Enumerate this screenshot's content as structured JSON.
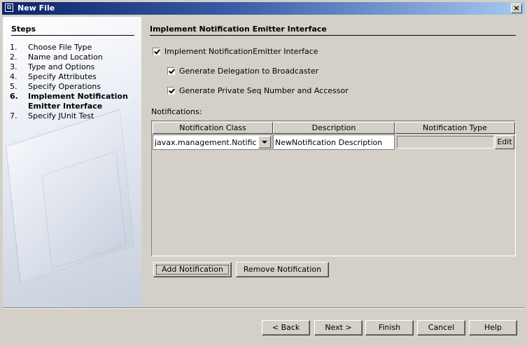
{
  "window": {
    "title": "New File",
    "close_label": "×"
  },
  "steps": {
    "header": "Steps",
    "items": [
      {
        "num": "1.",
        "label": "Choose File Type"
      },
      {
        "num": "2.",
        "label": "Name and Location"
      },
      {
        "num": "3.",
        "label": "Type and Options"
      },
      {
        "num": "4.",
        "label": "Specify Attributes"
      },
      {
        "num": "5.",
        "label": "Specify Operations"
      },
      {
        "num": "6.",
        "label": "Implement Notification",
        "label2": "Emitter Interface",
        "active": true
      },
      {
        "num": "7.",
        "label": "Specify JUnit Test"
      }
    ]
  },
  "panel": {
    "title": "Implement Notification Emitter Interface",
    "checkboxes": {
      "implement": {
        "label": "Implement NotificationEmitter Interface",
        "checked": true
      },
      "delegation": {
        "label": "Generate Delegation to Broadcaster",
        "checked": true
      },
      "seq": {
        "label": "Generate Private Seq Number and Accessor",
        "checked": true
      }
    },
    "notifications_label": "Notifications:",
    "table": {
      "columns": [
        "Notification Class",
        "Description",
        "Notification Type"
      ],
      "rows": [
        {
          "class": "javax.management.Notification",
          "description": "NewNotification Description",
          "type": "",
          "edit_label": "Edit"
        }
      ]
    },
    "add_button": "Add Notification",
    "remove_button": "Remove Notification"
  },
  "footer": {
    "back": "< Back",
    "next": "Next >",
    "finish": "Finish",
    "cancel": "Cancel",
    "help": "Help"
  },
  "icons": {
    "window": "netbeans-window-icon",
    "close": "close-icon",
    "dropdown": "chevron-down-icon"
  }
}
